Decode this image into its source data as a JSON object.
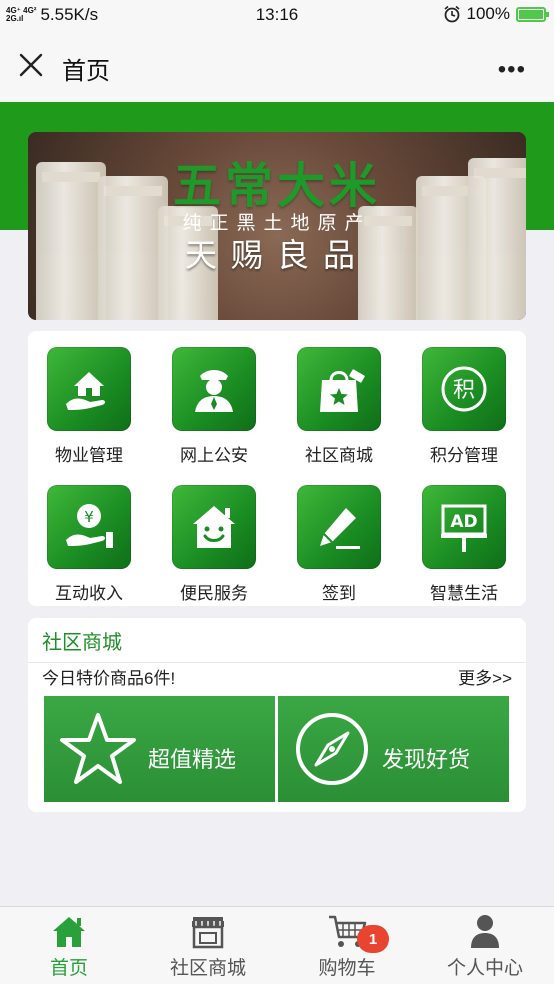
{
  "status_bar": {
    "network_top": "4G⁺ 4G²",
    "network_bottom": "2G.ıl",
    "speed": "5.55K/s",
    "time": "13:16",
    "battery": "100%",
    "battery_level": 1.0,
    "icons": {
      "alarm": "alarm-clock-icon",
      "battery": "battery-charging-icon"
    }
  },
  "navbar": {
    "title": "首页",
    "more": "•••",
    "close_icon": "close-icon"
  },
  "banner": {
    "title": "五常大米",
    "subtitle": "纯正黑土地原产",
    "slogan": "天赐良品"
  },
  "grid": [
    {
      "label": "物业管理",
      "icon": "house-hand-icon"
    },
    {
      "label": "网上公安",
      "icon": "police-icon"
    },
    {
      "label": "社区商城",
      "icon": "shopping-bag-star-icon"
    },
    {
      "label": "积分管理",
      "icon": "points-icon",
      "glyph": "积"
    },
    {
      "label": "互动收入",
      "icon": "money-hand-icon",
      "glyph": "¥"
    },
    {
      "label": "便民服务",
      "icon": "smile-house-icon"
    },
    {
      "label": "签到",
      "icon": "pencil-icon"
    },
    {
      "label": "智慧生活",
      "icon": "ad-board-icon",
      "glyph": "AD"
    }
  ],
  "mall": {
    "title": "社区商城",
    "today": "今日特价商品6件!",
    "more": "更多>>",
    "promos": [
      {
        "label": "超值精选",
        "icon": "star-outline-icon"
      },
      {
        "label": "发现好货",
        "icon": "compass-icon"
      }
    ]
  },
  "tabbar": {
    "items": [
      {
        "label": "首页",
        "icon": "home-icon",
        "active": true
      },
      {
        "label": "社区商城",
        "icon": "store-icon"
      },
      {
        "label": "购物车",
        "icon": "cart-icon",
        "badge": "1"
      },
      {
        "label": "个人中心",
        "icon": "person-icon"
      }
    ]
  },
  "colors": {
    "brand_green": "#1f9a1a",
    "tile_green": "#1a8c22",
    "badge_red": "#e8442f"
  }
}
